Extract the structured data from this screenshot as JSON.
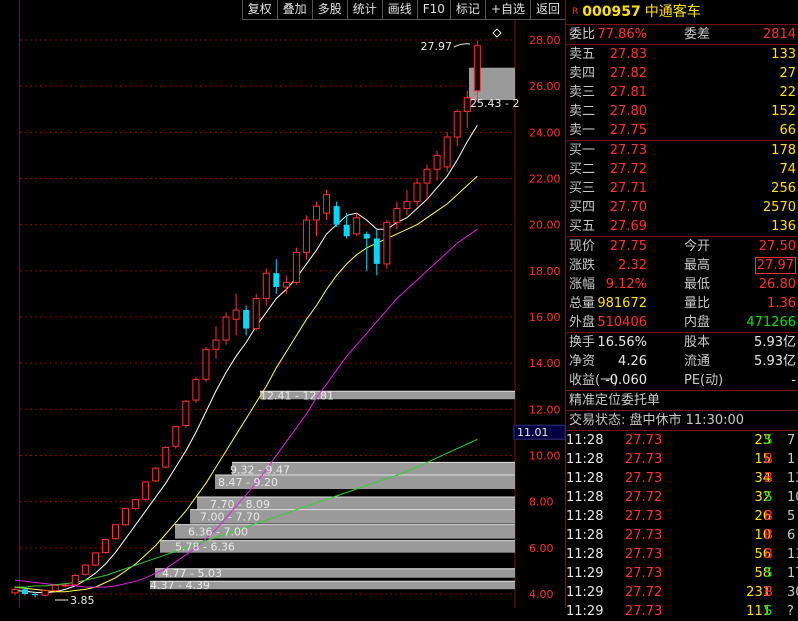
{
  "toolbar": {
    "items": [
      "复权",
      "叠加",
      "多股",
      "统计",
      "画线",
      "F10",
      "标记",
      "+自选",
      "返回"
    ]
  },
  "chart_data": {
    "type": "candlestick",
    "y_axis_ticks": [
      "28.00",
      "26.00",
      "24.00",
      "22.00",
      "20.00",
      "18.00",
      "16.00",
      "14.00",
      "12.00",
      "10.00",
      "8.00",
      "6.00",
      "4.00"
    ],
    "ylim": [
      3.4,
      29.0
    ],
    "current_price_label": "11.01",
    "annotations": {
      "high": "27.97",
      "low": "3.85",
      "range_top": "25.43 - 2"
    },
    "volume_profile_labels": [
      "12.41 - 12.81",
      "9.32 - 9.47",
      "8.47 - 9.20",
      "7.70 - 8.09",
      "7.00 - 7.70",
      "6.36 - 7.00",
      "5.78 - 6.36",
      "4.77 - 5.03",
      "4.37 - 4.39"
    ],
    "candles": [
      {
        "o": 4.05,
        "h": 4.35,
        "l": 3.95,
        "c": 4.2
      },
      {
        "o": 4.2,
        "h": 4.3,
        "l": 3.95,
        "c": 4.0
      },
      {
        "o": 4.0,
        "h": 4.1,
        "l": 3.85,
        "c": 3.95
      },
      {
        "o": 3.95,
        "h": 4.2,
        "l": 3.9,
        "c": 4.15
      },
      {
        "o": 4.15,
        "h": 4.4,
        "l": 4.1,
        "c": 4.37
      },
      {
        "o": 4.37,
        "h": 4.45,
        "l": 4.3,
        "c": 4.39
      },
      {
        "o": 4.4,
        "h": 4.85,
        "l": 4.38,
        "c": 4.8
      },
      {
        "o": 4.85,
        "h": 5.3,
        "l": 4.8,
        "c": 5.25
      },
      {
        "o": 5.25,
        "h": 5.8,
        "l": 5.2,
        "c": 5.78
      },
      {
        "o": 5.8,
        "h": 6.4,
        "l": 5.75,
        "c": 6.36
      },
      {
        "o": 6.4,
        "h": 7.0,
        "l": 6.35,
        "c": 7.0
      },
      {
        "o": 7.0,
        "h": 7.7,
        "l": 6.95,
        "c": 7.7
      },
      {
        "o": 7.7,
        "h": 8.1,
        "l": 7.65,
        "c": 8.09
      },
      {
        "o": 8.1,
        "h": 8.9,
        "l": 8.05,
        "c": 8.85
      },
      {
        "o": 8.9,
        "h": 9.5,
        "l": 8.85,
        "c": 9.45
      },
      {
        "o": 9.5,
        "h": 10.4,
        "l": 9.45,
        "c": 10.35
      },
      {
        "o": 10.4,
        "h": 11.3,
        "l": 10.3,
        "c": 11.25
      },
      {
        "o": 11.3,
        "h": 12.4,
        "l": 11.2,
        "c": 12.35
      },
      {
        "o": 12.4,
        "h": 13.4,
        "l": 12.3,
        "c": 13.3
      },
      {
        "o": 13.3,
        "h": 14.7,
        "l": 13.2,
        "c": 14.6
      },
      {
        "o": 14.6,
        "h": 15.6,
        "l": 14.2,
        "c": 15.0
      },
      {
        "o": 15.0,
        "h": 16.2,
        "l": 14.8,
        "c": 16.0
      },
      {
        "o": 15.9,
        "h": 17.0,
        "l": 15.2,
        "c": 16.3
      },
      {
        "o": 16.3,
        "h": 16.5,
        "l": 15.2,
        "c": 15.5
      },
      {
        "o": 15.5,
        "h": 17.0,
        "l": 15.4,
        "c": 16.8
      },
      {
        "o": 16.8,
        "h": 18.1,
        "l": 16.5,
        "c": 17.9
      },
      {
        "o": 17.9,
        "h": 18.5,
        "l": 17.0,
        "c": 17.3
      },
      {
        "o": 17.3,
        "h": 17.8,
        "l": 17.0,
        "c": 17.5
      },
      {
        "o": 17.5,
        "h": 19.0,
        "l": 17.4,
        "c": 18.8
      },
      {
        "o": 18.8,
        "h": 20.4,
        "l": 18.5,
        "c": 20.2
      },
      {
        "o": 20.2,
        "h": 21.0,
        "l": 19.5,
        "c": 20.8
      },
      {
        "o": 20.5,
        "h": 21.5,
        "l": 20.2,
        "c": 21.3
      },
      {
        "o": 20.8,
        "h": 21.0,
        "l": 19.9,
        "c": 20.0
      },
      {
        "o": 20.0,
        "h": 20.5,
        "l": 19.4,
        "c": 19.5
      },
      {
        "o": 19.6,
        "h": 20.5,
        "l": 19.5,
        "c": 20.3
      },
      {
        "o": 19.6,
        "h": 19.7,
        "l": 18.0,
        "c": 19.4
      },
      {
        "o": 19.4,
        "h": 19.8,
        "l": 17.8,
        "c": 18.3
      },
      {
        "o": 18.3,
        "h": 20.2,
        "l": 18.1,
        "c": 20.1
      },
      {
        "o": 20.1,
        "h": 21.0,
        "l": 19.8,
        "c": 20.7
      },
      {
        "o": 20.7,
        "h": 21.5,
        "l": 20.4,
        "c": 21.0
      },
      {
        "o": 21.0,
        "h": 22.0,
        "l": 20.8,
        "c": 21.8
      },
      {
        "o": 21.8,
        "h": 22.6,
        "l": 21.1,
        "c": 22.4
      },
      {
        "o": 22.4,
        "h": 23.2,
        "l": 21.9,
        "c": 23.0
      },
      {
        "o": 22.5,
        "h": 24.0,
        "l": 22.3,
        "c": 23.8
      },
      {
        "o": 23.8,
        "h": 25.0,
        "l": 23.4,
        "c": 24.9
      },
      {
        "o": 24.9,
        "h": 25.8,
        "l": 24.2,
        "c": 25.5
      },
      {
        "o": 25.8,
        "h": 27.97,
        "l": 25.3,
        "c": 27.75
      }
    ],
    "ma_white": [
      4.15,
      4.12,
      4.07,
      4.05,
      4.1,
      4.2,
      4.35,
      4.6,
      4.9,
      5.3,
      5.8,
      6.4,
      7.0,
      7.6,
      8.2,
      8.8,
      9.5,
      10.2,
      11.0,
      11.9,
      12.8,
      13.6,
      14.3,
      14.9,
      15.6,
      16.2,
      16.8,
      17.2,
      17.7,
      18.3,
      18.9,
      19.6,
      20.0,
      20.4,
      20.5,
      20.2,
      19.8,
      19.8,
      20.1,
      20.3,
      20.7,
      21.1,
      21.6,
      22.1,
      22.8,
      23.6,
      24.3
    ],
    "ma_yellow": [
      4.3,
      4.25,
      4.2,
      4.15,
      4.1,
      4.1,
      4.15,
      4.2,
      4.3,
      4.5,
      4.7,
      5.0,
      5.3,
      5.7,
      6.1,
      6.6,
      7.1,
      7.6,
      8.2,
      8.8,
      9.5,
      10.2,
      10.9,
      11.6,
      12.3,
      13.0,
      13.8,
      14.5,
      15.2,
      15.9,
      16.5,
      17.2,
      17.8,
      18.3,
      18.7,
      19.0,
      19.2,
      19.4,
      19.6,
      19.8,
      20.0,
      20.3,
      20.6,
      20.9,
      21.3,
      21.7,
      22.1
    ],
    "ma_magenta": [
      4.6,
      4.55,
      4.5,
      4.45,
      4.4,
      4.4,
      4.35,
      4.3,
      4.3,
      4.3,
      4.35,
      4.45,
      4.55,
      4.7,
      4.9,
      5.1,
      5.4,
      5.7,
      6.0,
      6.4,
      6.8,
      7.3,
      7.8,
      8.3,
      8.8,
      9.4,
      10.0,
      10.6,
      11.2,
      11.8,
      12.5,
      13.1,
      13.7,
      14.3,
      14.8,
      15.3,
      15.8,
      16.3,
      16.8,
      17.2,
      17.6,
      18.0,
      18.4,
      18.8,
      19.2,
      19.5,
      19.8
    ],
    "ma_green": [
      4.3,
      4.3,
      4.35,
      4.35,
      4.4,
      4.45,
      4.5,
      4.6,
      4.7,
      4.8,
      4.95,
      5.1,
      5.25,
      5.4,
      5.55,
      5.7,
      5.85,
      6.0,
      6.15,
      6.3,
      6.45,
      6.6,
      6.75,
      6.9,
      7.05,
      7.2,
      7.35,
      7.5,
      7.65,
      7.8,
      7.95,
      8.1,
      8.25,
      8.4,
      8.55,
      8.7,
      8.85,
      9.0,
      9.15,
      9.3,
      9.5,
      9.7,
      9.9,
      10.1,
      10.3,
      10.5,
      10.7
    ]
  },
  "quote": {
    "r_mark": "R",
    "code": "000957",
    "name": "中通客车",
    "weibi_label": "委比",
    "weibi_value": "77.86%",
    "weicha_label": "委差",
    "weicha_value": "2814",
    "asks": [
      {
        "label": "卖五",
        "price": "27.83",
        "vol": "133"
      },
      {
        "label": "卖四",
        "price": "27.82",
        "vol": "27"
      },
      {
        "label": "卖三",
        "price": "27.81",
        "vol": "22"
      },
      {
        "label": "卖二",
        "price": "27.80",
        "vol": "152"
      },
      {
        "label": "卖一",
        "price": "27.75",
        "vol": "66"
      }
    ],
    "bids": [
      {
        "label": "买一",
        "price": "27.73",
        "vol": "178"
      },
      {
        "label": "买二",
        "price": "27.72",
        "vol": "74"
      },
      {
        "label": "买三",
        "price": "27.71",
        "vol": "256"
      },
      {
        "label": "买四",
        "price": "27.70",
        "vol": "2570"
      },
      {
        "label": "买五",
        "price": "27.69",
        "vol": "136"
      }
    ],
    "stats": {
      "xianjia_label": "现价",
      "xianjia": "27.75",
      "jinkai_label": "今开",
      "jinkai": "27.50",
      "zhangdie_label": "涨跌",
      "zhangdie": "2.32",
      "zuigao_label": "最高",
      "zuigao": "27.97",
      "zhangfu_label": "涨幅",
      "zhangfu": "9.12%",
      "zuidi_label": "最低",
      "zuidi": "26.80",
      "zongliang_label": "总量",
      "zongliang": "981672",
      "liangbi_label": "量比",
      "liangbi": "1.36",
      "waipan_label": "外盘",
      "waipan": "510406",
      "neipan_label": "内盘",
      "neipan": "471266"
    },
    "fund": {
      "huanshou_label": "换手",
      "huanshou": "16.56%",
      "guben_label": "股本",
      "guben": "5.93亿",
      "jingzi_label": "净资",
      "jingzi": "4.26",
      "liutong_label": "流通",
      "liutong": "5.93亿",
      "shouyi_label": "收益(一)",
      "shouyi": "-0.060",
      "pe_label": "PE(动)",
      "pe": "-"
    },
    "precise_title": "精准定位委托单",
    "trade_status": "交易状态: 盘中休市 11:30:00"
  },
  "ticks": [
    {
      "time": "11:28",
      "price": "27.73",
      "vol": "23",
      "flag": "S",
      "num": "7"
    },
    {
      "time": "11:28",
      "price": "27.73",
      "vol": "15",
      "flag": "B",
      "num": "1"
    },
    {
      "time": "11:28",
      "price": "27.73",
      "vol": "34",
      "flag": "B",
      "num": "13"
    },
    {
      "time": "11:28",
      "price": "27.72",
      "vol": "32",
      "flag": "S",
      "num": "10"
    },
    {
      "time": "11:28",
      "price": "27.73",
      "vol": "26",
      "flag": "B",
      "num": "5"
    },
    {
      "time": "11:28",
      "price": "27.73",
      "vol": "10",
      "flag": "B",
      "num": "6"
    },
    {
      "time": "11:28",
      "price": "27.73",
      "vol": "56",
      "flag": "B",
      "num": "11"
    },
    {
      "time": "11:29",
      "price": "27.73",
      "vol": "58",
      "flag": "S",
      "num": "17"
    },
    {
      "time": "11:29",
      "price": "27.72",
      "vol": "231",
      "flag": "B",
      "num": "30"
    },
    {
      "time": "11:29",
      "price": "27.73",
      "vol": "111",
      "flag": "S",
      "num": "?"
    }
  ],
  "colors": {
    "up": "#ff3030",
    "down": "#00d8ff",
    "ma_white": "#ffffff",
    "ma_yellow": "#ffff40",
    "ma_magenta": "#e020e0",
    "ma_green": "#30d030",
    "grid": "#8a0000"
  }
}
